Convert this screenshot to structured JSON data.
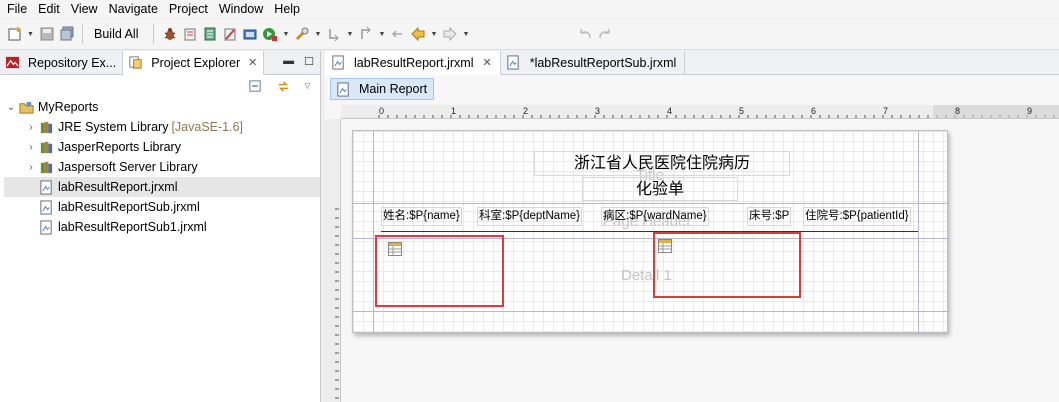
{
  "menu": [
    "File",
    "Edit",
    "View",
    "Navigate",
    "Project",
    "Window",
    "Help"
  ],
  "toolbar": {
    "build_all_label": "Build All"
  },
  "left_panel": {
    "tabs": [
      {
        "label": "Repository Ex...",
        "icon": "repository-icon"
      },
      {
        "label": "Project Explorer",
        "icon": "project-explorer-icon"
      }
    ],
    "tree": {
      "root": "MyReports",
      "items": [
        {
          "label": "JRE System Library",
          "suffix": "[JavaSE-1.6]",
          "icon": "library-icon",
          "expandable": true
        },
        {
          "label": "JasperReports Library",
          "suffix": "",
          "icon": "library-icon",
          "expandable": true
        },
        {
          "label": "Jaspersoft Server Library",
          "suffix": "",
          "icon": "library-icon",
          "expandable": true
        },
        {
          "label": "labResultReport.jrxml",
          "suffix": "",
          "icon": "report-file-icon",
          "expandable": false,
          "selected": true
        },
        {
          "label": "labResultReportSub.jrxml",
          "suffix": "",
          "icon": "report-file-icon",
          "expandable": false
        },
        {
          "label": "labResultReportSub1.jrxml",
          "suffix": "",
          "icon": "report-file-icon",
          "expandable": false
        }
      ]
    }
  },
  "editor": {
    "tabs": [
      {
        "label": "labResultReport.jrxml",
        "active": true
      },
      {
        "label": "*labResultReportSub.jrxml",
        "active": false
      }
    ],
    "subtab": "Main Report",
    "ruler_numbers": [
      "0",
      "1",
      "2",
      "3",
      "4",
      "5",
      "6",
      "7",
      "8",
      "9"
    ],
    "report": {
      "title_line1": "浙江省人民医院住院病历",
      "title_line2": "化验单",
      "title_band_label": "Title",
      "page_header_label": "Page Header",
      "detail_label": "Detail 1",
      "fields": [
        {
          "label": "姓名:",
          "value": "$P{name}"
        },
        {
          "label": "科室:",
          "value": "$P{deptName}"
        },
        {
          "label": "病区:",
          "value": "$P{wardName}"
        },
        {
          "label": "床号:",
          "value": "$P"
        },
        {
          "label": "住院号:",
          "value": "$P{patientId}"
        }
      ]
    }
  },
  "colors": {
    "subreport_border": "#e03a3a",
    "band_line": "#b6b6d9",
    "subtab_bg": "#d9e8f8"
  }
}
